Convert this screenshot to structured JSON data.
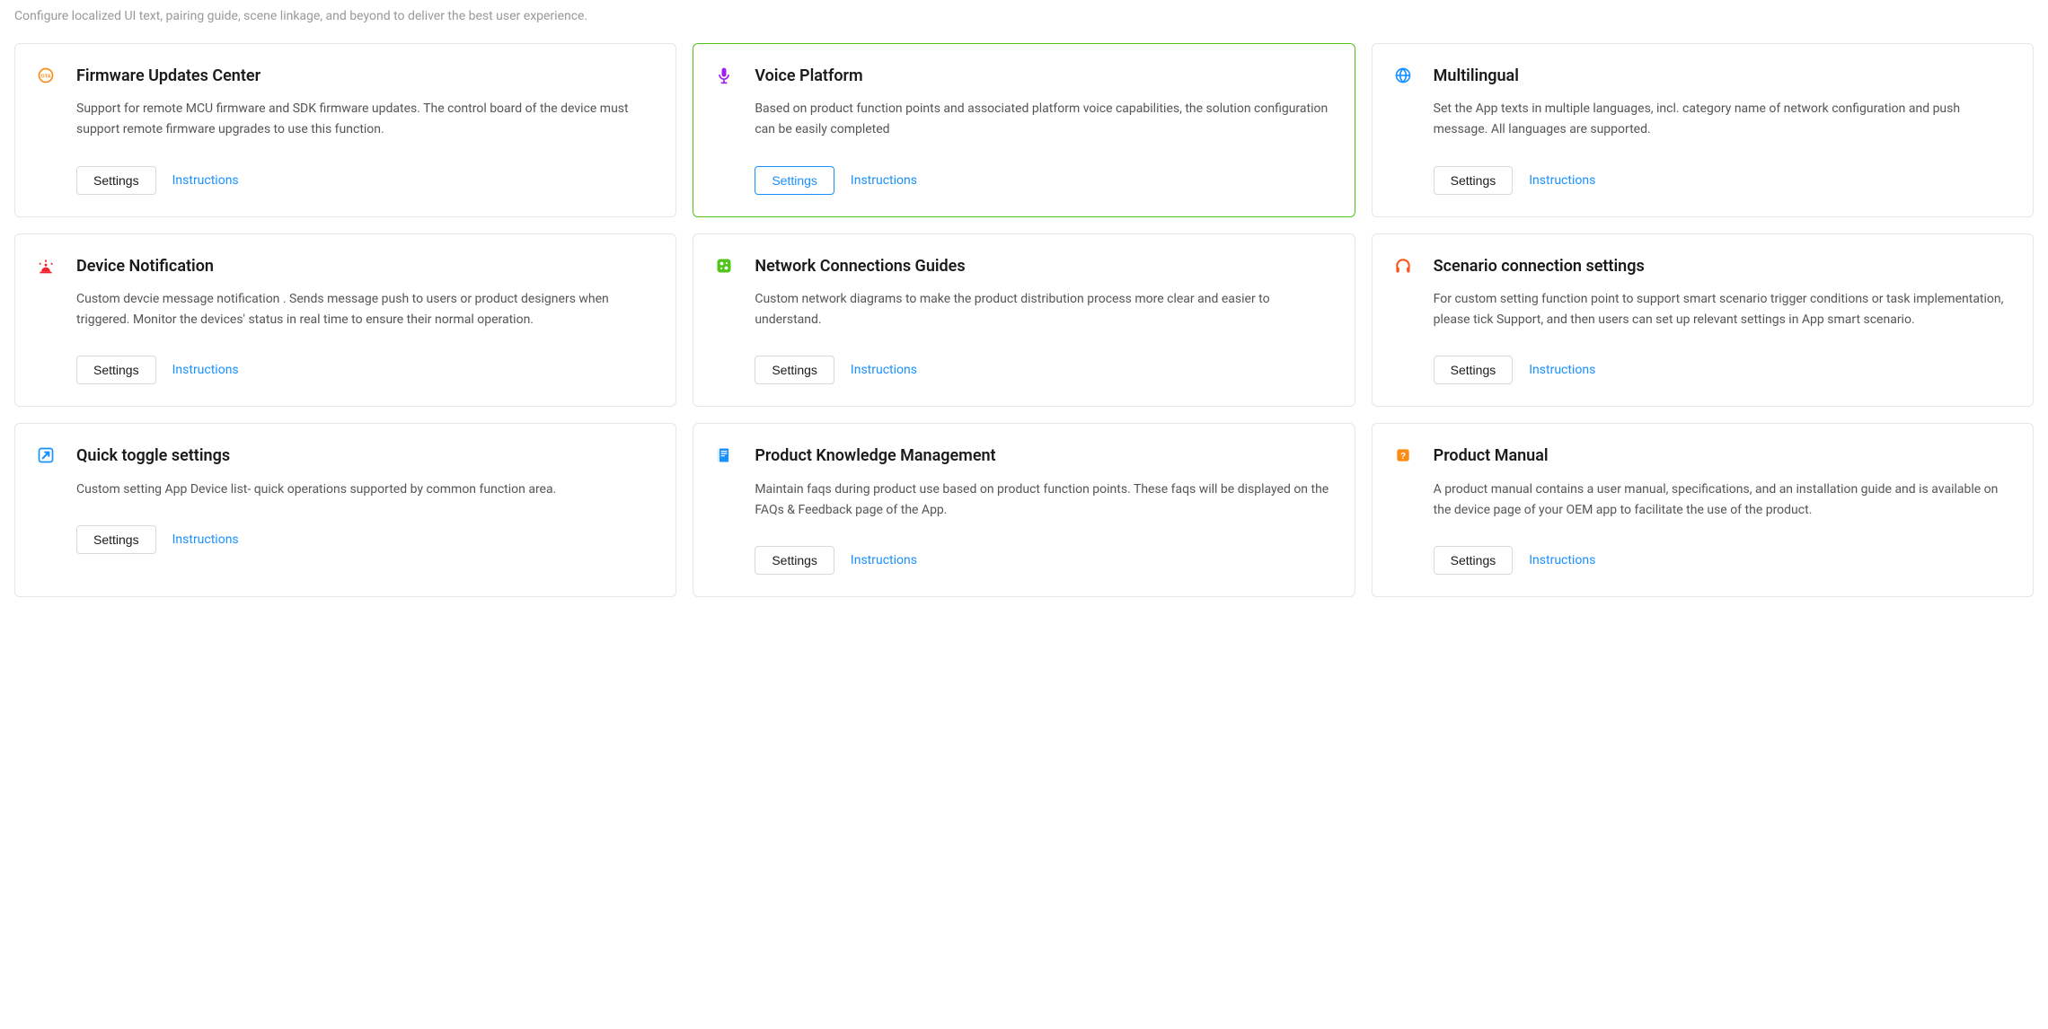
{
  "subtitle": "Configure localized UI text, pairing guide, scene linkage, and beyond to deliver the best user experience.",
  "labels": {
    "settings": "Settings",
    "instructions": "Instructions"
  },
  "cards": [
    {
      "id": "firmware-updates-center",
      "icon": "ota-icon",
      "title": "Firmware Updates Center",
      "desc": "Support for remote MCU firmware and SDK firmware updates. The control board of the device must support remote firmware upgrades to use this function.",
      "highlight": false
    },
    {
      "id": "voice-platform",
      "icon": "microphone-icon",
      "title": "Voice Platform",
      "desc": "Based on product function points and associated platform voice capabilities, the solution configuration can be easily completed",
      "highlight": true
    },
    {
      "id": "multilingual",
      "icon": "globe-icon",
      "title": "Multilingual",
      "desc": "Set the App texts in multiple languages, incl. category name of network configuration and push message. All languages are supported.",
      "highlight": false
    },
    {
      "id": "device-notification",
      "icon": "alarm-icon",
      "title": "Device Notification",
      "desc": "Custom devcie message notification . Sends message push to users or product designers when triggered. Monitor the devices' status in real time to ensure their normal operation.",
      "highlight": false
    },
    {
      "id": "network-connections-guides",
      "icon": "network-icon",
      "title": "Network Connections Guides",
      "desc": "Custom network diagrams to make the product distribution process more clear and easier to understand.",
      "highlight": false
    },
    {
      "id": "scenario-connection-settings",
      "icon": "headphones-icon",
      "title": "Scenario connection settings",
      "desc": "For custom setting function point to support smart scenario trigger conditions or task implementation, please tick Support, and then users can set up relevant settings in App smart scenario.",
      "highlight": false
    },
    {
      "id": "quick-toggle-settings",
      "icon": "toggle-arrow-icon",
      "title": "Quick toggle settings",
      "desc": "Custom setting App Device list- quick operations supported by common function area.",
      "highlight": false
    },
    {
      "id": "product-knowledge-management",
      "icon": "book-icon",
      "title": "Product Knowledge Management",
      "desc": "Maintain faqs during product use based on product function points. These faqs will be displayed on the FAQs & Feedback page of the App.",
      "highlight": false
    },
    {
      "id": "product-manual",
      "icon": "manual-icon",
      "title": "Product Manual",
      "desc": "A product manual contains a user manual, specifications, and an installation guide and is available on the device page of your OEM app to facilitate the use of the product.",
      "highlight": false
    }
  ],
  "icon_colors": {
    "ota-icon": "#fa8c16",
    "microphone-icon": "#a020f0",
    "globe-icon": "#1890ff",
    "alarm-icon": "#f5222d",
    "network-icon": "#52c41a",
    "headphones-icon": "#fa541c",
    "toggle-arrow-icon": "#1890ff",
    "book-icon": "#1890ff",
    "manual-icon": "#fa8c16"
  }
}
